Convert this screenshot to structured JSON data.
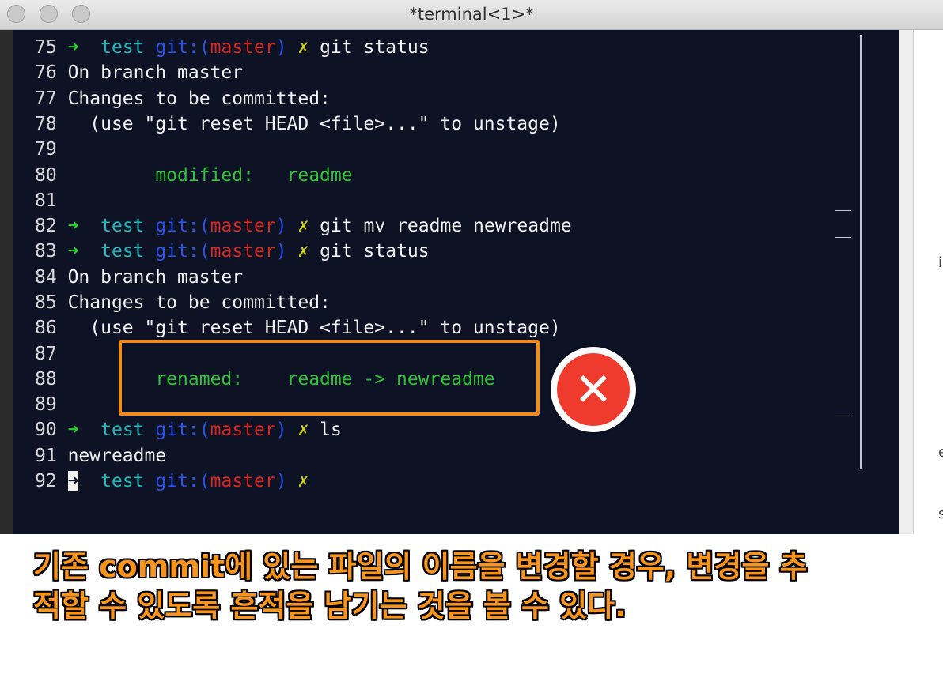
{
  "window": {
    "title": "*terminal<1>*"
  },
  "terminal": {
    "lines": [
      {
        "n": "75",
        "type": "prompt",
        "cmd": "git status"
      },
      {
        "n": "76",
        "type": "text",
        "text": "On branch master"
      },
      {
        "n": "77",
        "type": "text",
        "text": "Changes to be committed:"
      },
      {
        "n": "78",
        "type": "text",
        "text": "  (use \"git reset HEAD <file>...\" to unstage)"
      },
      {
        "n": "79",
        "type": "text",
        "text": ""
      },
      {
        "n": "80",
        "type": "green",
        "text": "        modified:   readme"
      },
      {
        "n": "81",
        "type": "text",
        "text": ""
      },
      {
        "n": "82",
        "type": "prompt",
        "cmd": "git mv readme newreadme"
      },
      {
        "n": "83",
        "type": "prompt",
        "cmd": "git status"
      },
      {
        "n": "84",
        "type": "text",
        "text": "On branch master"
      },
      {
        "n": "85",
        "type": "text",
        "text": "Changes to be committed:"
      },
      {
        "n": "86",
        "type": "text",
        "text": "  (use \"git reset HEAD <file>...\" to unstage)"
      },
      {
        "n": "87",
        "type": "text",
        "text": ""
      },
      {
        "n": "88",
        "type": "green",
        "text": "        renamed:    readme -> newreadme"
      },
      {
        "n": "89",
        "type": "text",
        "text": ""
      },
      {
        "n": "90",
        "type": "prompt",
        "cmd": "ls"
      },
      {
        "n": "91",
        "type": "text",
        "text": "newreadme"
      },
      {
        "n": "92",
        "type": "prompt",
        "cmd": "",
        "cursor": true
      }
    ],
    "prompt": {
      "arrow": "➜",
      "dir": "test",
      "git_open": "git:(",
      "branch": "master",
      "git_close": ")",
      "dirty": "✗"
    },
    "colors": {
      "background": "#0d1224",
      "arrow": "#27d12e",
      "dir": "#22b8b8",
      "git": "#2b53e8",
      "branch": "#d7261f",
      "dirty": "#d2d21c",
      "status_green": "#30c43a"
    }
  },
  "annotation": {
    "highlight_color": "#f28b18",
    "badge_icon": "close-icon",
    "badge_glyph": "✕",
    "badge_color": "#ef3b2d"
  },
  "side_panel": {
    "fragments": [
      "i",
      "e",
      "s"
    ]
  },
  "caption": {
    "color": "#f7941d",
    "lines": [
      "기존 commit에 있는 파일의 이름을 변경할 경우, 변경을 추",
      "적할 수 있도록 흔적을 남기는 것을 볼 수 있다."
    ]
  }
}
